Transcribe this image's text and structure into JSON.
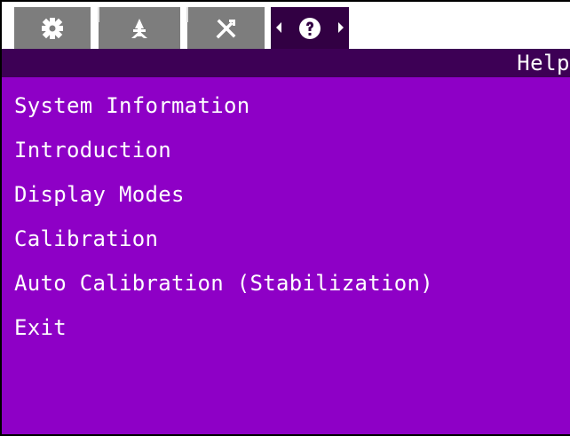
{
  "tabs": [
    {
      "icon": "gear-icon",
      "active": false
    },
    {
      "icon": "compass-icon",
      "active": false
    },
    {
      "icon": "tools-icon",
      "active": false
    },
    {
      "icon": "help-icon",
      "active": true
    }
  ],
  "header": {
    "title": "Help"
  },
  "menu": {
    "items": [
      {
        "label": "System Information"
      },
      {
        "label": "Introduction"
      },
      {
        "label": "Display Modes"
      },
      {
        "label": "Calibration"
      },
      {
        "label": "Auto Calibration (Stabilization)"
      },
      {
        "label": "Exit"
      }
    ]
  },
  "colors": {
    "background": "#8e00c6",
    "title_strip": "#3d0055",
    "tab_inactive": "#7d7d7d",
    "tab_active": "#320043",
    "text": "#ffffff"
  }
}
